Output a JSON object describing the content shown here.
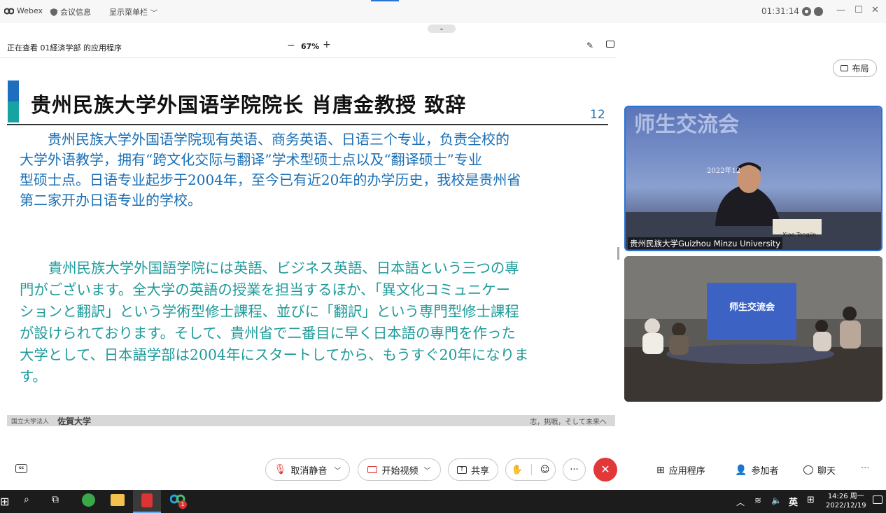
{
  "titlebar": {
    "app_name": "Webex",
    "meeting_info": "会议信息",
    "show_menu": "显示菜单栏",
    "time": "01:31:14"
  },
  "sharebar": {
    "viewing_text": "正在查看 01経済学部 的应用程序",
    "zoom": "67%",
    "zoom_minus": "−",
    "zoom_plus": "+"
  },
  "layout_button": "布局",
  "slide": {
    "title": "贵州民族大学外国语学院院长  肖唐金教授  致辞",
    "page_number": "12",
    "cn_lines": [
      "　　贵州民族大学外国语学院现有英语、商务英语、日语三个专业，负责全校的",
      "大学外语教学，拥有“跨文化交际与翻译”学术型硕士点以及“翻译硕士”专业",
      "型硕士点。日语专业起步于2004年，至今已有近20年的办学历史，我校是贵州省",
      "第二家开办日语专业的学校。"
    ],
    "jp_lines": [
      "　　貴州民族大学外国語学院には英語、ビジネス英語、日本語という三つの専",
      "門がございます。全大学の英語の授業を担当するほか、「異文化コミュニケー",
      "ションと翻訳」という学術型修士課程、並びに「翻訳」という専門型修士課程",
      "が設けられております。そして、貴州省で二番目に早く日本語の専門を作った",
      "大学として、日本語学部は2004年にスタートしてから、もうすぐ20年になりま",
      "す。"
    ],
    "footer_left_small": "国立大学法人",
    "footer_left_big": "佐賀大学",
    "footer_right": "志，挑戦，そして未来へ"
  },
  "videos": {
    "top_label": "贵州民族大学Guizhou Minzu University",
    "top_banner": "师生交流会",
    "top_date": "2022年12",
    "top_nameplate": "Xiao Tangjin",
    "bottom_banner": "师生交流会"
  },
  "controls": {
    "unmute": "取消静音",
    "start_video": "开始视频",
    "share": "共享",
    "more": "···",
    "apps": "应用程序",
    "participants": "参加者",
    "chat": "聊天",
    "overflow": "···"
  },
  "taskbar": {
    "time": "14:26 周一",
    "date": "2022/12/19",
    "ime": "英",
    "badge": "1"
  },
  "colors": {
    "accent_blue": "#1a6fb5",
    "accent_teal": "#1e9a9a",
    "end_call_red": "#e23838",
    "active_border": "#2a73d6"
  }
}
